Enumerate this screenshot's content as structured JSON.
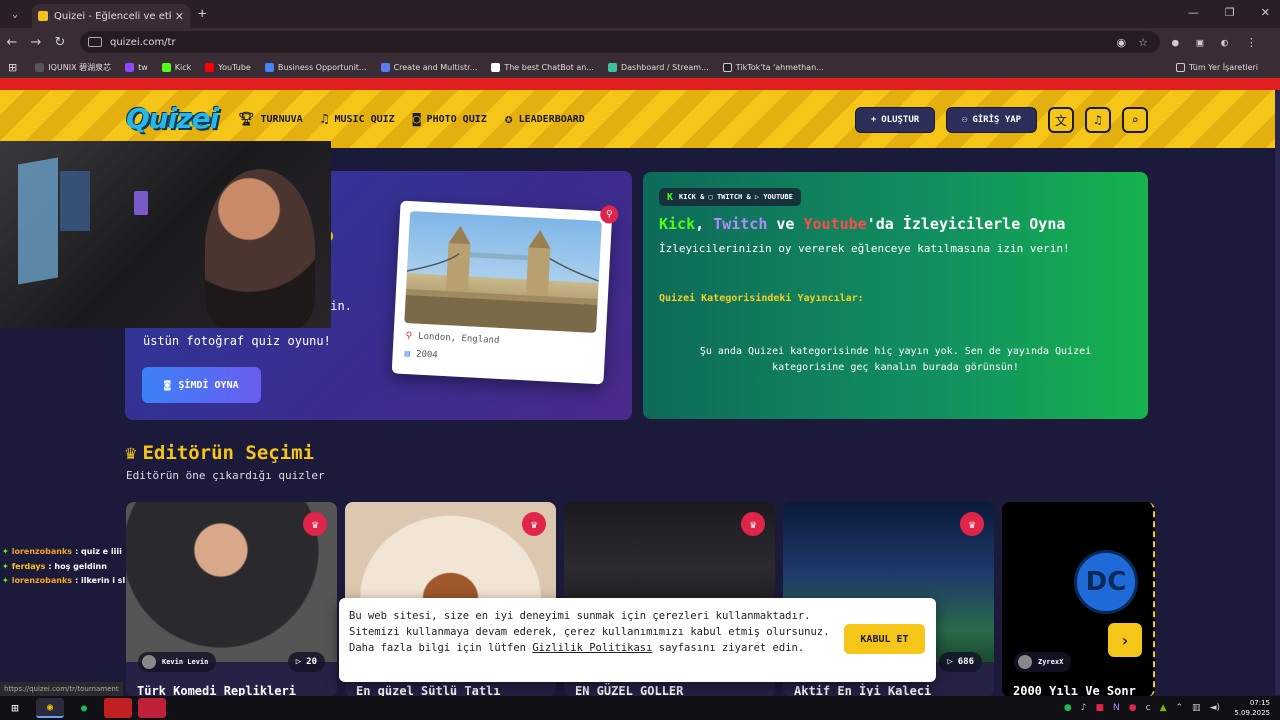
{
  "browser": {
    "tab_title": "Quizei - Eğlenceli ve etkileşimli",
    "url": "quizei.com/tr",
    "bookmarks": [
      "IQUNIX 碧湖泉芯",
      "tw",
      "Kick",
      "YouTube",
      "Business Opportunit...",
      "Create and Multistr...",
      "The best ChatBot an...",
      "Dashboard / Stream...",
      "TikTok'ta 'ahmethan..."
    ],
    "all_bookmarks": "Tüm Yer İşaretleri",
    "status_url": "https://quizei.com/tr/tournament"
  },
  "site": {
    "logo": "Quizei",
    "nav": [
      "TURNUVA",
      "MUSIC QUIZ",
      "PHOTO QUIZ",
      "LEADERBOARD"
    ],
    "create_label": "OLUŞTUR",
    "login_label": "GİRİŞ YAP"
  },
  "hero_left": {
    "title_fragment": "o",
    "line1": "din.",
    "line2": "üstün fotoğraf quiz oyunu!",
    "play_label": "ŞİMDİ OYNA",
    "photo_location": "London, England",
    "photo_year": "2004"
  },
  "hero_right": {
    "badge": "KICK & ▢ TWITCH & ▷ YOUTUBE",
    "title_kick": "Kick",
    "title_sep1": ", ",
    "title_twitch": "Twitch",
    "title_mid": " ve ",
    "title_yt": "Youtube",
    "title_end": "'da İzleyicilerle Oyna",
    "subtitle": "İzleyicilerinizin oy vererek eğlenceye katılmasına izin verin!",
    "category_label": "Quizei Kategorisindeki Yayıncılar:",
    "empty_message": "Şu anda Quizei kategorisinde hiç yayın yok. Sen de yayında Quizei kategorisine geç kanalın burada görünsün!"
  },
  "editors": {
    "title": "Editörün Seçimi",
    "subtitle": "Editörün öne çıkardığı quizler",
    "cards": [
      {
        "title": "Türk Komedi Replikleri",
        "author": "Kevin Levin",
        "plays": "20"
      },
      {
        "title": "En güzel Sütlü Tatlı",
        "author": "",
        "plays": ""
      },
      {
        "title": "EN GÜZEL GOLLER",
        "author": "",
        "plays": ""
      },
      {
        "title": "Aktif En İyi Kaleci",
        "author": "",
        "plays": "686"
      },
      {
        "title": "2000 Yılı Ve Sonr",
        "author": "ZyrexX",
        "plays": ""
      }
    ]
  },
  "cookie": {
    "message_a": "Bu web sitesi, size en iyi deneyimi sunmak için çerezleri kullanmaktadır. Sitemizi kullanmaya devam ederek, çerez kullanımımızı kabul etmiş olursunuz. Daha fazla bilgi için lütfen ",
    "link": "Gizlilik Politikası",
    "message_b": " sayfasını ziyaret edin.",
    "accept_label": "KABUL ET"
  },
  "chat": [
    {
      "user": "lorenzobanks",
      "text": ": quiz e iiii"
    },
    {
      "user": "ferdays",
      "text": ": hoş geldinn"
    },
    {
      "user": "lorenzobanks",
      "text": ": ilkerin i sl"
    }
  ],
  "taskbar": {
    "time": "07:15",
    "date": "5.09.2025"
  },
  "colors": {
    "header_yellow": "#f5c518",
    "kick_green": "#53fc18",
    "twitch_purple": "#b58cff",
    "youtube_red": "#ff4b4b",
    "crown_red": "#e0254a"
  }
}
